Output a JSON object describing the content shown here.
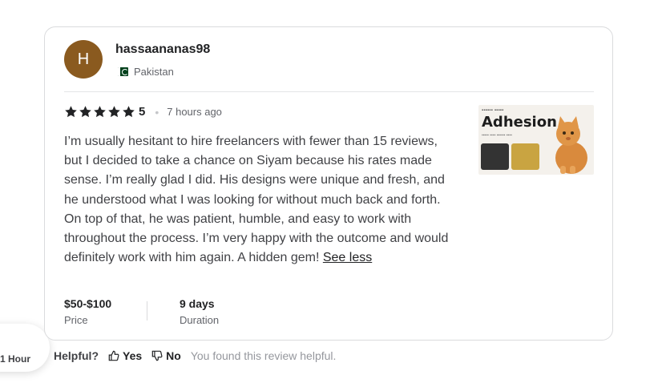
{
  "review": {
    "avatar_initial": "H",
    "username": "hassaananas98",
    "country": "Pakistan",
    "rating": "5",
    "stars": 5,
    "time_ago": "7 hours ago",
    "text": "I’m usually hesitant to hire freelancers with fewer than 15 reviews, but I decided to take a chance on Siyam because his rates made sense. I’m really glad I did. His designs were unique and fresh, and he understood what I was looking for without much back and forth. On top of that, he was patient, humble, and easy to work with throughout the process. I’m very happy with the outcome and would definitely work with him again. A hidden gem!",
    "see_less_label": "See less",
    "price_value": "$50-$100",
    "price_label": "Price",
    "duration_value": "9 days",
    "duration_label": "Duration",
    "thumbnail": {
      "title": "Adhesion",
      "icon": "cat-product-image"
    }
  },
  "helpful": {
    "question": "Helpful?",
    "yes_label": "Yes",
    "no_label": "No",
    "message": "You found this review helpful."
  },
  "side_bubble": {
    "text": "1 Hour"
  },
  "colors": {
    "avatar_bg": "#8a5a1f",
    "star": "#222325",
    "flag_green": "#01411c"
  }
}
